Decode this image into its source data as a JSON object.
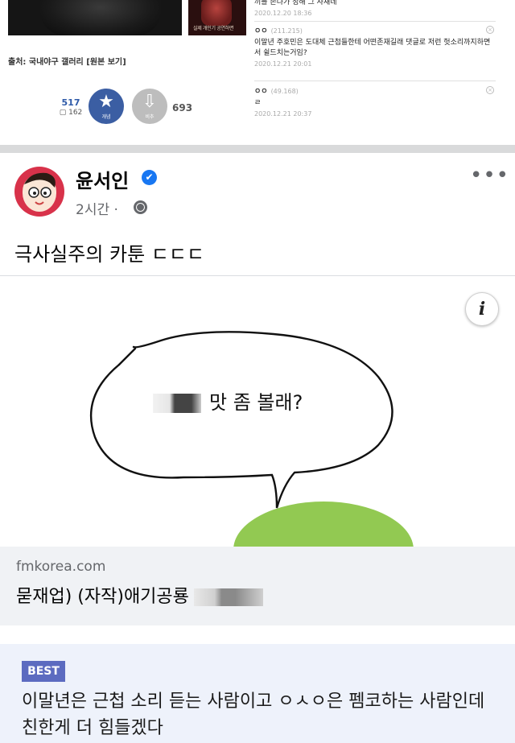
{
  "top_post": {
    "thumb_caption": "실제 개인기 공연하면",
    "source_prefix": "출처: 국내야구 갤러리 ",
    "source_link": "[원본 보기]",
    "vote": {
      "up_count": "517",
      "sub_count": "162",
      "up_label": "개념",
      "down_label": "비추",
      "down_count": "693",
      "up_symbol": "★",
      "down_symbol": "⇩"
    },
    "comments": [
      {
        "text": "끼를 존나가 정해 그 사새데",
        "date": "2020.12.20 18:36"
      },
      {
        "nick": "ㅇㅇ",
        "ip": "(211.215)",
        "text": "이말년 주호민은 도대체 근첩들한테 어떤존재길래 댓글로 저런 헛소리까지하면서 쉴드치는거임?",
        "date": "2020.12.21 20:01"
      },
      {
        "nick": "ㅇㅇ",
        "ip": "(49.168)",
        "text": "ㄹ",
        "date": "2020.12.21 20:37"
      }
    ]
  },
  "fb_post": {
    "author": "윤서인",
    "verified_icon": "✔",
    "time": "2시간 · ",
    "more": "•••",
    "text": "극사실주의 카툰 ㄷㄷㄷ",
    "link_card": {
      "info_icon": "i",
      "speech_text": "맛 좀 볼래?",
      "domain": "fmkorea.com",
      "title": "묻재업) (자작)애기공룡"
    }
  },
  "best_comment": {
    "badge": "BEST",
    "text": "이말년은 근첩 소리 듣는 사람이고 ㅇㅅㅇ은 펨코하는 사람인데 친한게 더 힘들겠다"
  },
  "colors": {
    "fb_blue": "#1877f2",
    "vote_blue": "#3b5ea3",
    "best_badge": "#5c6bc0",
    "speech_green": "#92c952"
  }
}
